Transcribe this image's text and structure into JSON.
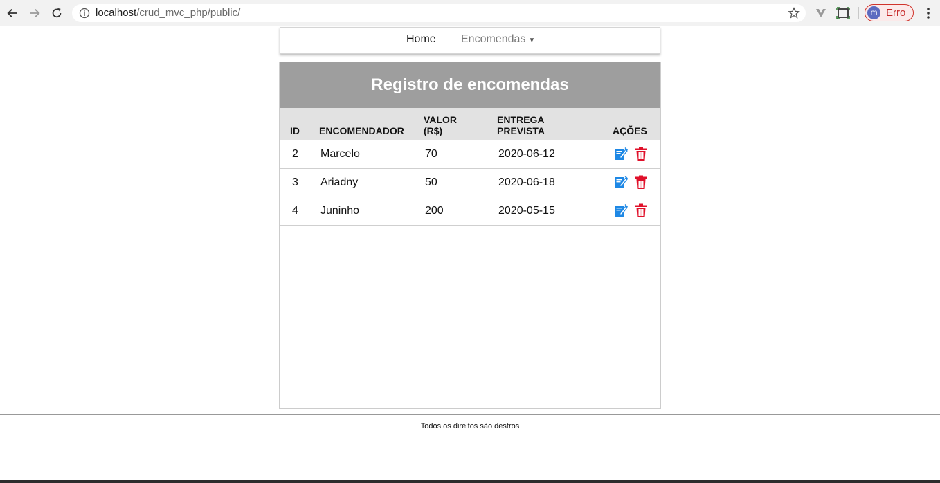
{
  "browser": {
    "url_host": "localhost",
    "url_path": "/crud_mvc_php/public/",
    "profile_initial": "m",
    "profile_label": "Erro"
  },
  "nav": {
    "home": "Home",
    "orders": "Encomendas",
    "orders_caret": "▼"
  },
  "panel": {
    "title": "Registro de encomendas"
  },
  "table": {
    "headers": {
      "id": "ID",
      "orderer": "ENCOMENDADOR",
      "value_line1": "VALOR",
      "value_line2": "(R$)",
      "delivery_line1": "ENTREGA",
      "delivery_line2": "PREVISTA",
      "actions": "AÇÕES"
    },
    "rows": [
      {
        "id": "2",
        "orderer": "Marcelo",
        "value": "70",
        "delivery": "2020-06-12"
      },
      {
        "id": "3",
        "orderer": "Ariadny",
        "value": "50",
        "delivery": "2020-06-18"
      },
      {
        "id": "4",
        "orderer": "Juninho",
        "value": "200",
        "delivery": "2020-05-15"
      }
    ]
  },
  "footer": {
    "text": "Todos os direitos são destros"
  },
  "colors": {
    "header_bg": "#9e9e9e",
    "edit_icon": "#1e88e5",
    "delete_icon": "#e0102a"
  }
}
